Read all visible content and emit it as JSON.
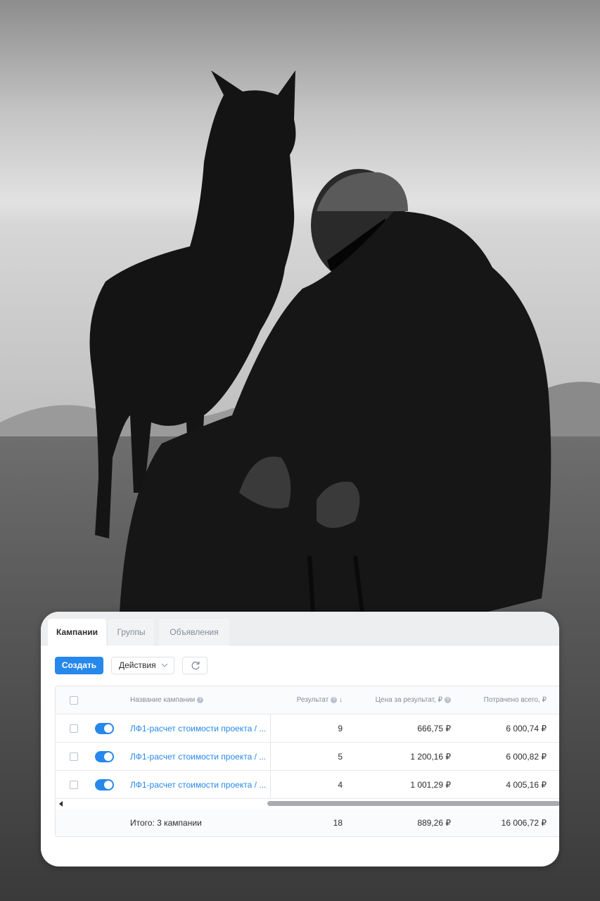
{
  "tabs": [
    {
      "label": "Кампании",
      "active": true
    },
    {
      "label": "Группы",
      "active": false
    },
    {
      "label": "Объявления",
      "active": false
    }
  ],
  "toolbar": {
    "create_label": "Создать",
    "actions_label": "Действия"
  },
  "table": {
    "columns": {
      "name": "Название кампании",
      "result": "Результат",
      "result_sort": "↓",
      "price": "Цена за результат, ₽",
      "spent": "Потрачено всего, ₽"
    },
    "rows": [
      {
        "name": "ЛФ1-расчет стоимости проекта / ...",
        "result": "9",
        "price": "666,75 ₽",
        "spent": "6 000,74 ₽",
        "enabled": true
      },
      {
        "name": "ЛФ1-расчет стоимости проекта / ...",
        "result": "5",
        "price": "1 200,16 ₽",
        "spent": "6 000,82 ₽",
        "enabled": true
      },
      {
        "name": "ЛФ1-расчет стоимости проекта / ...",
        "result": "4",
        "price": "1 001,29 ₽",
        "spent": "4 005,16 ₽",
        "enabled": true
      }
    ],
    "total": {
      "label": "Итого: 3 кампании",
      "result": "18",
      "price": "889,26 ₽",
      "spent": "16 006,72 ₽"
    }
  },
  "colors": {
    "accent": "#2688eb",
    "text": "#2c2d2e",
    "muted": "#818c99"
  },
  "icons": [
    "chevron-down-icon",
    "refresh-icon",
    "info-icon",
    "scroll-left-icon"
  ]
}
